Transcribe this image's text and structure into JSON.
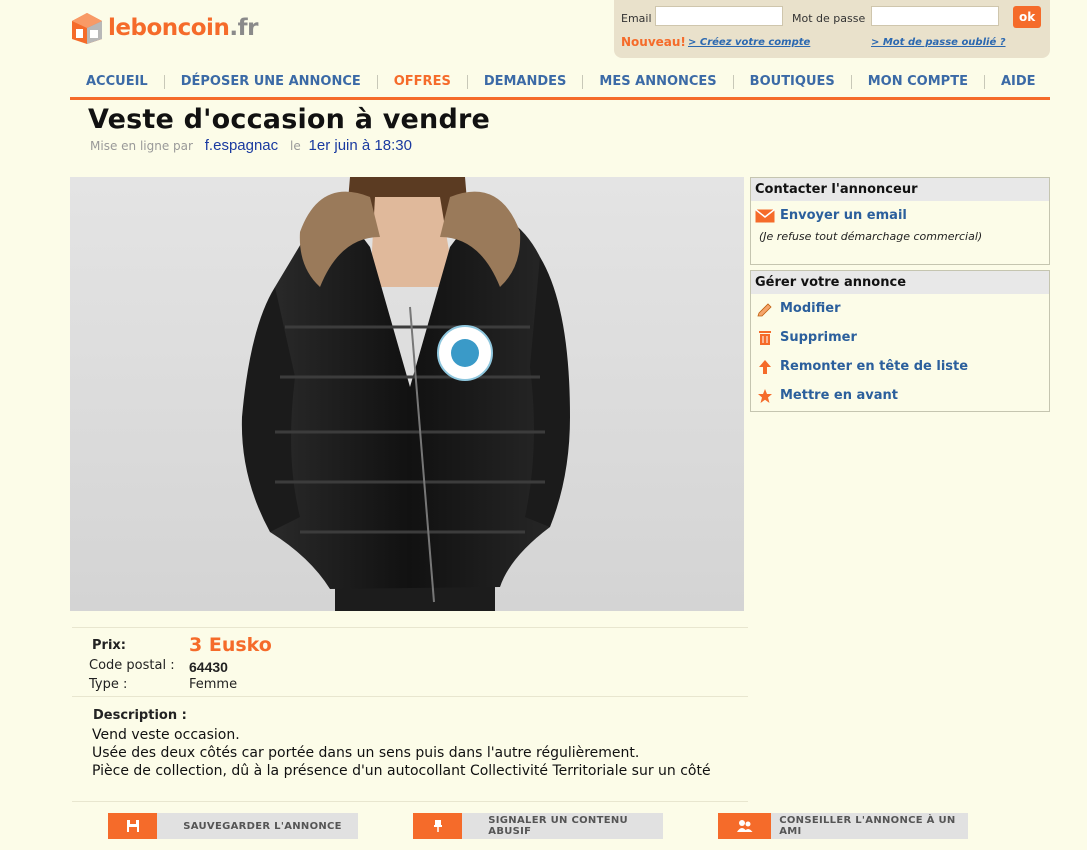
{
  "brand": {
    "name": "leboncoin",
    "tld": ".fr"
  },
  "login": {
    "email_label": "Email",
    "password_label": "Mot de passe",
    "email_value": "",
    "password_value": "",
    "ok_label": "ok",
    "nouveau": "Nouveau!",
    "create_account": "> Créez votre compte",
    "forgot_password": "> Mot de passe oublié ?"
  },
  "nav": [
    {
      "label": "ACCUEIL"
    },
    {
      "label": "DÉPOSER UNE ANNONCE"
    },
    {
      "label": "OFFRES",
      "active": true
    },
    {
      "label": "DEMANDES"
    },
    {
      "label": "MES ANNONCES"
    },
    {
      "label": "BOUTIQUES"
    },
    {
      "label": "MON COMPTE"
    },
    {
      "label": "AIDE"
    }
  ],
  "ad": {
    "title": "Veste d'occasion à vendre",
    "posted_prefix": "Mise en ligne par",
    "user": "f.espagnac",
    "le": "le",
    "date": "1er juin à 18:30",
    "price_label": "Prix:",
    "price": "3 Eusko",
    "postcode_label": "Code postal :",
    "postcode": "64430",
    "type_label": "Type :",
    "type": "Femme",
    "description_label": "Description :",
    "description": [
      "Vend veste occasion.",
      "Usée des deux côtés car portée dans un sens puis dans l'autre régulièrement.",
      "Pièce de collection, dû à la présence d'un autocollant Collectivité Territoriale sur un côté"
    ]
  },
  "contact_box": {
    "title": "Contacter l'annonceur",
    "email_link": "Envoyer un email",
    "note": "(Je refuse tout démarchage commercial)"
  },
  "manage_box": {
    "title": "Gérer votre annonce",
    "items": [
      "Modifier",
      "Supprimer",
      "Remonter en tête de liste",
      "Mettre en avant"
    ]
  },
  "actions": {
    "save": "SAUVEGARDER L'ANNONCE",
    "report": "SIGNALER UN CONTENU ABUSIF",
    "share": "CONSEILLER L'ANNONCE À UN AMI"
  },
  "colors": {
    "accent": "#f56b2a",
    "link": "#2b5f9c",
    "background": "#fcfce8"
  },
  "icons": {
    "logo": "house-logo-icon",
    "email": "envelope-icon",
    "edit": "pencil-icon",
    "delete": "trash-icon",
    "bump": "arrow-up-icon",
    "feature": "star-icon",
    "save": "floppy-icon",
    "report": "pin-icon",
    "share": "people-icon"
  }
}
